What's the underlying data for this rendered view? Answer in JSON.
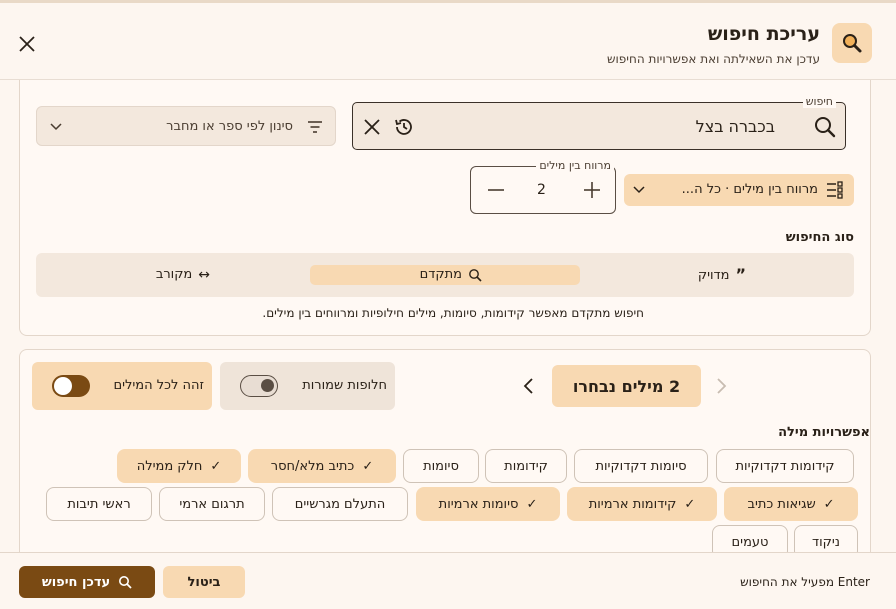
{
  "dialog": {
    "title": "עריכת חיפוש",
    "subtitle": "עדכן את השאילתה ואת אפשרויות החיפוש"
  },
  "search": {
    "label": "חיפוש",
    "value": "בכברה בצל"
  },
  "filter": {
    "placeholder": "סינון לפי ספר או מחבר"
  },
  "distance": {
    "label": "מרווח בין מילים",
    "value": "2",
    "pill_label": "מרווח בין מילים · כל ה..."
  },
  "search_type": {
    "heading": "סוג החיפוש",
    "options": [
      {
        "label": "מדויק",
        "icon": "quote-icon",
        "active": false
      },
      {
        "label": "מתקדם",
        "icon": "search-icon",
        "active": true
      },
      {
        "label": "מקורב",
        "icon": "arrows-icon",
        "active": false
      }
    ],
    "description": "חיפוש מתקדם מאפשר קידומות, סיומות, מילים חילופיות ומרווחים בין מילים."
  },
  "words": {
    "selected_label": "2 מילים נבחרו",
    "toggle_all_label": "זהה לכל המילים",
    "toggle_all_on": true,
    "toggle_saved_label": "חלופות שמורות",
    "toggle_saved_on": false
  },
  "word_options": {
    "heading": "אפשרויות מילה",
    "row1": [
      {
        "label": "קידומות דקדוקיות",
        "on": false
      },
      {
        "label": "סיומות דקדוקיות",
        "on": false
      },
      {
        "label": "קידומות",
        "on": false
      },
      {
        "label": "סיומות",
        "on": false
      },
      {
        "label": "כתיב מלא/חסר",
        "on": true
      },
      {
        "label": "חלק ממילה",
        "on": true
      }
    ],
    "row2": [
      {
        "label": "שגיאות כתיב",
        "on": true
      },
      {
        "label": "קידומות ארמיות",
        "on": true
      },
      {
        "label": "סיומות ארמיות",
        "on": true
      },
      {
        "label": "התעלם מגרשיים",
        "on": false
      },
      {
        "label": "תרגום ארמי",
        "on": false
      },
      {
        "label": "ראשי תיבות",
        "on": false
      }
    ],
    "row3": [
      {
        "label": "ניקוד",
        "on": false
      },
      {
        "label": "טעמים",
        "on": false
      }
    ]
  },
  "footer": {
    "hint": "Enter מפעיל את החיפוש",
    "cancel_label": "ביטול",
    "update_label": "עדכן חיפוש"
  },
  "colors": {
    "accent": "#f8d9b2",
    "primary": "#7a4a13"
  }
}
